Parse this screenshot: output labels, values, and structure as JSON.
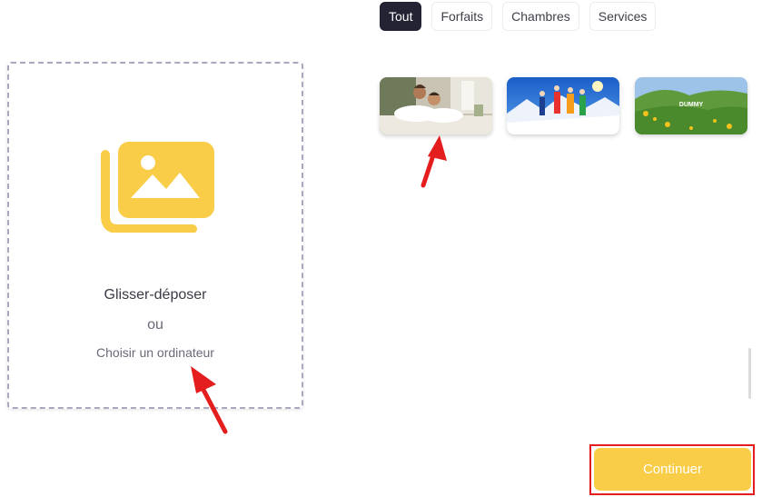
{
  "filters": [
    {
      "label": "Tout",
      "active": true
    },
    {
      "label": "Forfaits",
      "active": false
    },
    {
      "label": "Chambres",
      "active": false
    },
    {
      "label": "Services",
      "active": false
    }
  ],
  "upload": {
    "icon": "images-icon",
    "title": "Glisser-déposer",
    "or_text": "ou",
    "choose_label": "Choisir un ordinateur"
  },
  "gallery": [
    {
      "icon": "spa-couple-image"
    },
    {
      "icon": "ski-group-image"
    },
    {
      "icon": "green-meadow-image",
      "caption": "DUMMY"
    }
  ],
  "actions": {
    "continue_label": "Continuer"
  },
  "colors": {
    "accent": "#f9cd48",
    "active_tab": "#232333",
    "annotation": "#e41e1e"
  }
}
